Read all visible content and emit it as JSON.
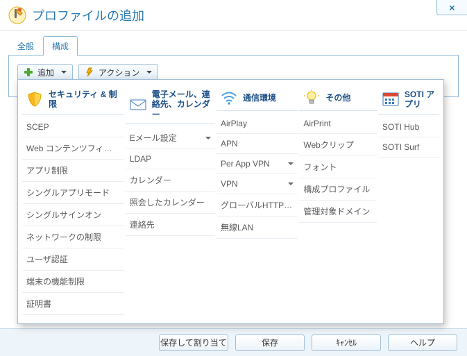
{
  "window": {
    "title": "プロファイルの追加",
    "close_label": "×"
  },
  "tabs": {
    "general": "全般",
    "structure": "構成"
  },
  "toolbar": {
    "add": "追加",
    "action": "アクション"
  },
  "columns": [
    {
      "icon": "shield",
      "title": "セキュリティ & 制限",
      "items": [
        {
          "label": "SCEP"
        },
        {
          "label": "Web コンテンツフィルタ"
        },
        {
          "label": "アプリ制限"
        },
        {
          "label": "シングルアプリモード"
        },
        {
          "label": "シングルサインオン"
        },
        {
          "label": "ネットワークの制限"
        },
        {
          "label": "ユーザ認証"
        },
        {
          "label": "端末の機能制限"
        },
        {
          "label": "証明書"
        }
      ]
    },
    {
      "icon": "mail",
      "title": "電子メール、連絡先、カレンダー",
      "items": [
        {
          "label": "Eメール設定",
          "submenu": true
        },
        {
          "label": "LDAP"
        },
        {
          "label": "カレンダー"
        },
        {
          "label": "照会したカレンダー"
        },
        {
          "label": "連絡先"
        }
      ]
    },
    {
      "icon": "wifi",
      "title": "通信環境",
      "items": [
        {
          "label": "AirPlay"
        },
        {
          "label": "APN"
        },
        {
          "label": "Per App VPN",
          "submenu": true
        },
        {
          "label": "VPN",
          "submenu": true
        },
        {
          "label": "グローバルHTTPプロキシ"
        },
        {
          "label": "無線LAN"
        }
      ]
    },
    {
      "icon": "bulb",
      "title": "その他",
      "items": [
        {
          "label": "AirPrint"
        },
        {
          "label": "Webクリップ"
        },
        {
          "label": "フォント"
        },
        {
          "label": "構成プロファイル"
        },
        {
          "label": "管理対象ドメイン"
        }
      ]
    },
    {
      "icon": "calendar",
      "title": "SOTI アプリ",
      "items": [
        {
          "label": "SOTI Hub"
        },
        {
          "label": "SOTI Surf"
        }
      ]
    }
  ],
  "footer": {
    "save_assign": "保存して割り当て",
    "save": "保存",
    "cancel": "ｷｬﾝｾﾙ",
    "help": "ヘルプ"
  }
}
